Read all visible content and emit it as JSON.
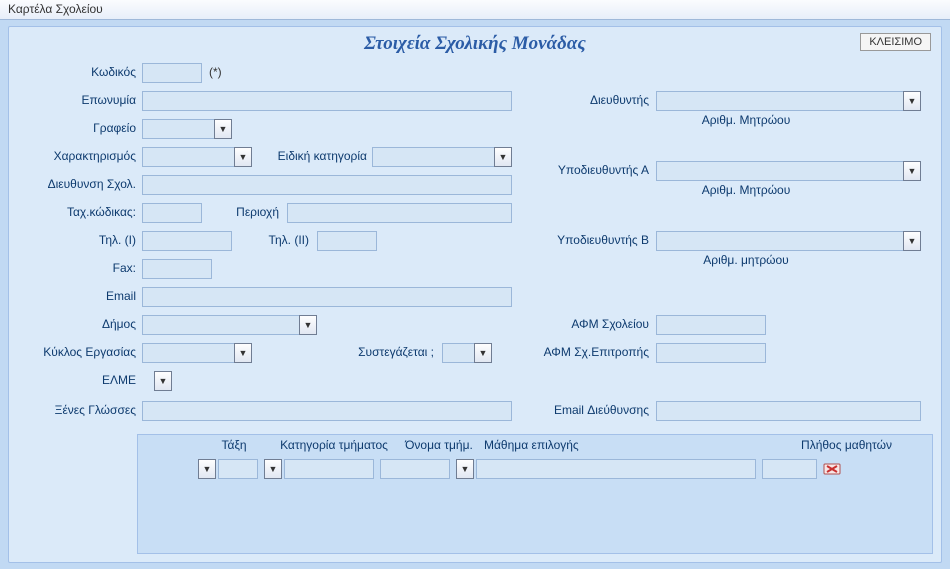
{
  "window": {
    "title": "Καρτέλα Σχολείου"
  },
  "page": {
    "title": "Στοιχεία Σχολικής Μονάδας",
    "close": "ΚΛΕΙΣΙΜΟ"
  },
  "labels": {
    "code": "Κωδικός",
    "code_note": "(*)",
    "name": "Επωνυμία",
    "office": "Γραφείο",
    "char": "Χαρακτηρισμός",
    "specialcat": "Ειδική κατηγορία",
    "schooladdr": "Διευθυνση Σχολ.",
    "postcode": "Ταχ.κώδικας:",
    "area": "Περιοχή",
    "tel1": "Τηλ. (Ι)",
    "tel2": "Τηλ. (ΙΙ)",
    "fax": "Fax:",
    "email": "Email",
    "muni": "Δήμος",
    "workcycle": "Κύκλος Εργασίας",
    "shared": "Συστεγάζεται ;",
    "elme": "ΕΛΜΕ",
    "langs": "Ξένες Γλώσσες",
    "director": "Διευθυντής",
    "regnum": "Αριθμ. Μητρώου",
    "regnum2": "Αριθμ. μητρώου",
    "subA": "Υποδιευθυντής  Α",
    "subB": "Υποδιευθυντής  Β",
    "afm_school": "ΑΦΜ Σχολείου",
    "afm_comm": "ΑΦΜ Σχ.Επιτροπής",
    "diremail": "Email Διεύθυνσης"
  },
  "grid": {
    "hdr": {
      "class": "Τάξη",
      "cat": "Κατηγορία τμήματος",
      "secname": "Όνομα τμήμ.",
      "elective": "Μάθημα επιλογής",
      "count": "Πλήθος μαθητών"
    }
  }
}
